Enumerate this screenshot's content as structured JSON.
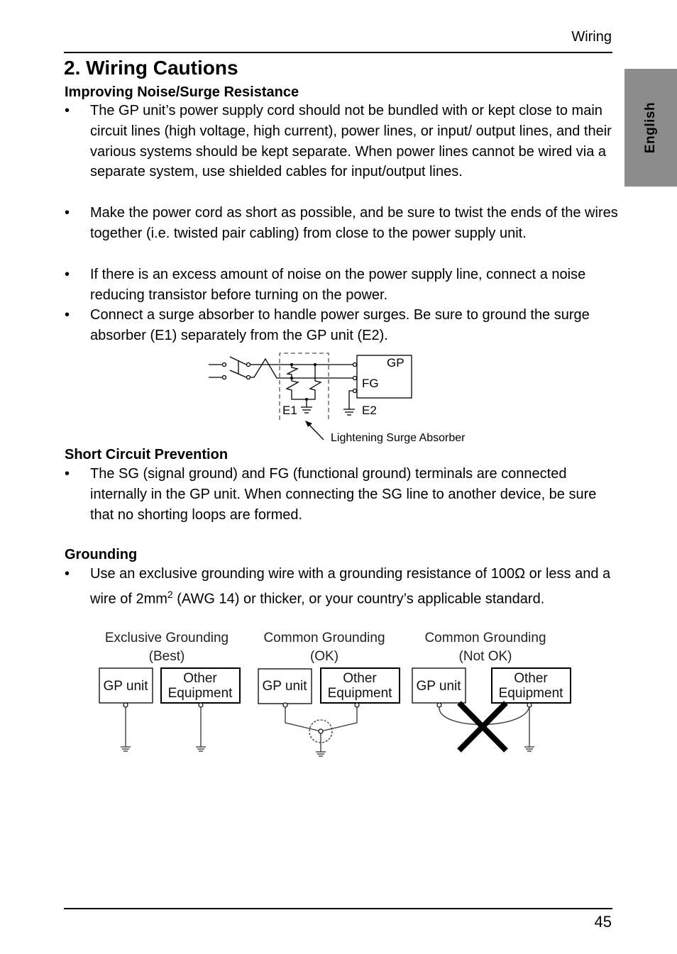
{
  "header": {
    "section": "Wiring",
    "language_tab": "English",
    "page_number": "45"
  },
  "title": "2. Wiring Cautions",
  "sections": [
    {
      "heading": "Improving Noise/Surge Resistance",
      "bullets": [
        "The GP unit’s power supply cord should not be bundled with or kept close to main circuit lines (high voltage, high current), power lines, or input/ output lines, and their various systems should be kept separate. When power lines cannot be wired via a separate system, use shielded cables for input/output lines.",
        "Make the power cord as short as possible, and be sure to twist the ends of the wires together (i.e. twisted pair cabling) from close to the power supply unit.",
        "If there is an excess amount of noise on the power supply line, connect a noise reducing transistor before turning on the power.",
        "Connect a surge absorber to handle power surges. Be sure to ground the surge absorber (E1) separately from the GP unit (E2)."
      ]
    },
    {
      "heading": "Short Circuit Prevention",
      "bullets": [
        "The SG (signal ground) and FG (functional ground) terminals are connected internally in the GP unit. When connecting the SG line to another device, be sure that no shorting loops are formed."
      ]
    },
    {
      "heading": "Grounding",
      "bullets": [
        {
          "pre": "Use an exclusive grounding wire with a grounding resistance of 100Ω or less and a wire of 2mm",
          "sup": "2",
          "post": " (AWG 14) or thicker, or your country’s applicable standard."
        }
      ]
    }
  ],
  "surge_diagram": {
    "gp_label": "GP",
    "fg_label": "FG",
    "e1_label": "E1",
    "e2_label": "E2",
    "caption": "Lightening Surge Absorber"
  },
  "grounding_diagrams": [
    {
      "title_line1": "Exclusive Grounding",
      "title_line2": "(Best)",
      "gp": "GP unit",
      "other_line1": "Other",
      "other_line2": "Equipment"
    },
    {
      "title_line1": "Common Grounding",
      "title_line2": "(OK)",
      "gp": "GP unit",
      "other_line1": "Other",
      "other_line2": "Equipment"
    },
    {
      "title_line1": "Common Grounding",
      "title_line2": "(Not OK)",
      "gp": "GP unit",
      "other_line1": "Other",
      "other_line2": "Equipment"
    }
  ]
}
